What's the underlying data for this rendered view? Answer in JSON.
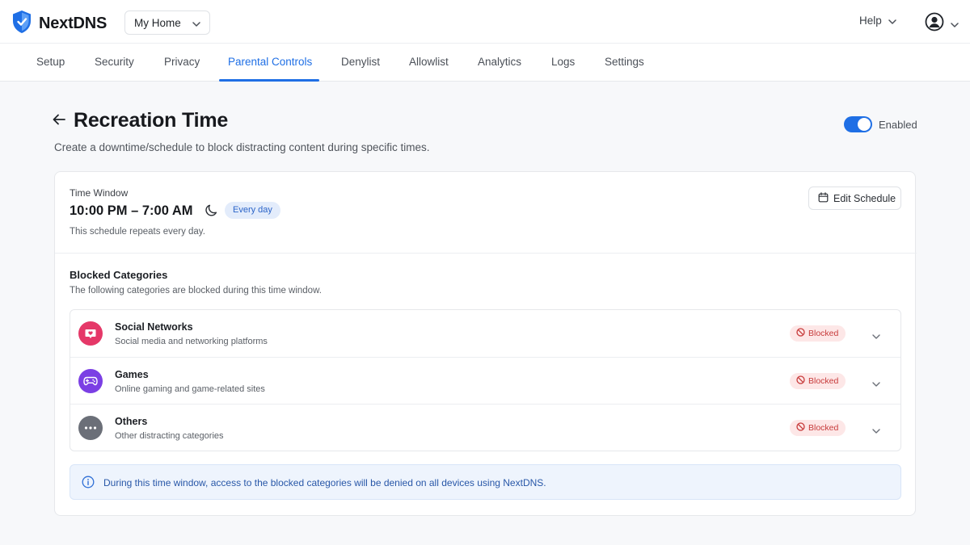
{
  "app": {
    "brand": "NextDNS",
    "profile": "My Home",
    "help_label": "Help"
  },
  "tabs": [
    {
      "label": "Setup"
    },
    {
      "label": "Security"
    },
    {
      "label": "Privacy"
    },
    {
      "label": "Parental Controls",
      "active": true
    },
    {
      "label": "Denylist"
    },
    {
      "label": "Allowlist"
    },
    {
      "label": "Analytics"
    },
    {
      "label": "Logs"
    },
    {
      "label": "Settings"
    }
  ],
  "page": {
    "title": "Recreation Time",
    "subtitle": "Create a downtime/schedule to block distracting content during specific times.",
    "toggle_state": true,
    "toggle_label": "Enabled"
  },
  "time_window": {
    "label": "Time Window",
    "range": "10:00 PM – 7:00 AM",
    "badge": "Every day",
    "note": "This schedule repeats every day.",
    "edit_label": "Edit Schedule"
  },
  "blocked": {
    "title": "Blocked Categories",
    "subtitle": "The following categories are blocked during this time window.",
    "categories": [
      {
        "name": "Social Networks",
        "desc": "Social media and networking platforms",
        "status": "Blocked",
        "icon": "heart-chat-icon",
        "color": "#e53868"
      },
      {
        "name": "Games",
        "desc": "Online gaming and game-related sites",
        "status": "Blocked",
        "icon": "gamepad-icon",
        "color": "#7b3fe4"
      },
      {
        "name": "Others",
        "desc": "Other distracting categories",
        "status": "Blocked",
        "icon": "more-dots-icon",
        "color": "#6b6f78"
      }
    ]
  },
  "info": {
    "text": "During this time window, access to the blocked categories will be denied on all devices using NextDNS."
  },
  "colors": {
    "accent": "#1f6fe5",
    "blocked_bg": "#fde7e7",
    "blocked_text": "#c73a3a",
    "info_bg": "#eef4fd"
  }
}
